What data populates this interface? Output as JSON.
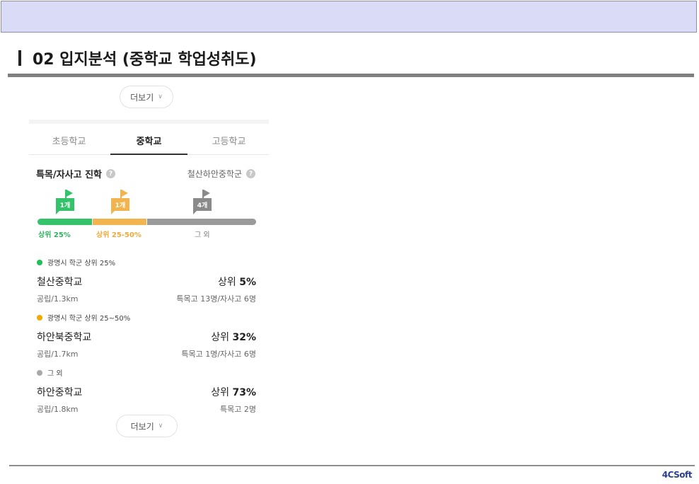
{
  "slide": {
    "title": "02 입지분석 (중학교 학업성취도)",
    "logo": "4CSoft"
  },
  "panel": {
    "more_top": "더보기",
    "more_bottom": "더보기",
    "tabs": [
      {
        "label": "초등학교",
        "active": false
      },
      {
        "label": "중학교",
        "active": true
      },
      {
        "label": "고등학교",
        "active": false
      }
    ],
    "section_title": "특목/자사고 진학",
    "section_right": "철산하안중학군",
    "flags": [
      {
        "label": "1개",
        "color": "#34c36b"
      },
      {
        "label": "1개",
        "color": "#f2b44e"
      },
      {
        "label": "4개",
        "color": "#9a9a9a"
      }
    ],
    "bar_labels": [
      "상위 25%",
      "상위 25-50%",
      "그 외"
    ],
    "groups": [
      {
        "header": "광명시 학군 상위 25%",
        "dot_color": "#1fbf59",
        "school": "철산중학교",
        "rank_prefix": "상위",
        "rank_value": "5%",
        "meta": "공립/1.3km",
        "detail": "특목고 13명/자사고 6명"
      },
      {
        "header": "광명시 학군 상위 25~50%",
        "dot_color": "#f2a900",
        "school": "하안북중학교",
        "rank_prefix": "상위",
        "rank_value": "32%",
        "meta": "공립/1.7km",
        "detail": "특목고 1명/자사고 6명"
      },
      {
        "header": "그 외",
        "dot_color": "#a8a8a8",
        "school": "하안중학교",
        "rank_prefix": "상위",
        "rank_value": "73%",
        "meta": "공립/1.8km",
        "detail": "특목고 2명"
      }
    ]
  }
}
